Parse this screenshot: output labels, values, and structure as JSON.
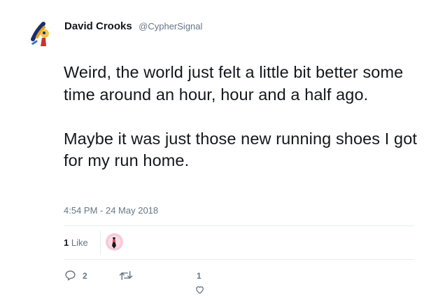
{
  "tweet": {
    "author_name": "David Crooks",
    "author_handle": "@CypherSignal",
    "text_paragraphs": [
      "Weird, the world just felt a little bit better some time around an hour, hour and a half ago.",
      "Maybe it was just those new running shoes I got for my run home."
    ],
    "timestamp": "4:54 PM - 24 May 2018",
    "likes_count": "1",
    "likes_label": "Like",
    "actions": {
      "reply_count": "2",
      "like_count": "1"
    }
  },
  "icons": {
    "avatar": "avatar-image",
    "liker_avatar": "avatar-image",
    "reply": "reply-icon",
    "retweet": "retweet-icon",
    "like": "heart-icon"
  },
  "colors": {
    "text": "#14171a",
    "secondary": "#657786",
    "divider": "#e6ecf0"
  }
}
